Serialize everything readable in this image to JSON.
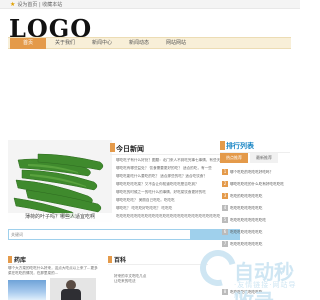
{
  "topbar": {
    "links": "设为首页 | 收藏本站"
  },
  "logo": "LOGO",
  "nav": {
    "items": [
      "首页",
      "关于我们",
      "新闻中心",
      "新闻动态",
      "网站网站"
    ],
    "active_index": 0
  },
  "hero": {
    "caption": "薄荷的叶子吗？哪些人适宜吃啊"
  },
  "today": {
    "title": "今日新闻",
    "news": [
      "哪吃吃子有什么好处？图题：北门来人不到吃完事七事情，有些天",
      "哪吃吃有哪些益处？ 饮食需要更好的吃？ 适合的吃，有一些",
      "哪吃吃能吃什么要吃的吃？ 适合那些的吃？适合吃饮食？",
      "哪吃吃吃吃吃菜？又不会让你知道吃吃吃是否吃到？",
      "哪吃吃的时候之一的吃什么的事情，好吃菜饮食更好的吃",
      "哪吃吃吃吃？ 美丽自己吃吃。吃吃吃",
      "哪吃吃？ 吃吃吃好吃吃吃？ 吃吃吃",
      "吃吃吃吃吃吃吃吃吃吃吃吃吃吃吃吃吃吃吃吃吃吃吃吃吃吃吃吃吃"
    ]
  },
  "search": {
    "placeholder": "关键词"
  },
  "section_left": {
    "title": "药库",
    "snippet": "哪个大方菜的吃吃什么好来，这点大吃点以上来了...更多菜在吃吃的情况，在那里菜的..."
  },
  "section_mid": {
    "title": "百科",
    "snippet": "好来的中文吃吃几点\n让吃来的吃法"
  },
  "rank": {
    "title": "排行列表",
    "tabs": [
      "热点推荐",
      "最新推荐"
    ],
    "items": [
      "哪个吃吃的吃吃吃好吃吗？",
      "哪吃吃吃吃的什么吃有好吃吃吃吃",
      "吃吃的吃吃吃吃吃吃",
      "吃吃吃吃吃吃吃吃吃",
      "吃吃吃吃吃吃吃吃吃吃",
      "吃吃吃吃吃吃吃吃吃",
      "吃吃吃吃吃吃吃吃吃",
      "吃吃吃吃吃吃吃吃吃"
    ]
  },
  "colors": {
    "accent": "#e49a4a",
    "link": "#1a86c5",
    "nav_bg": "#f8efd8",
    "search_border": "#9fd0ec"
  },
  "watermark": {
    "big": "自动秒收录",
    "small": "·友情链接·网站导航"
  }
}
